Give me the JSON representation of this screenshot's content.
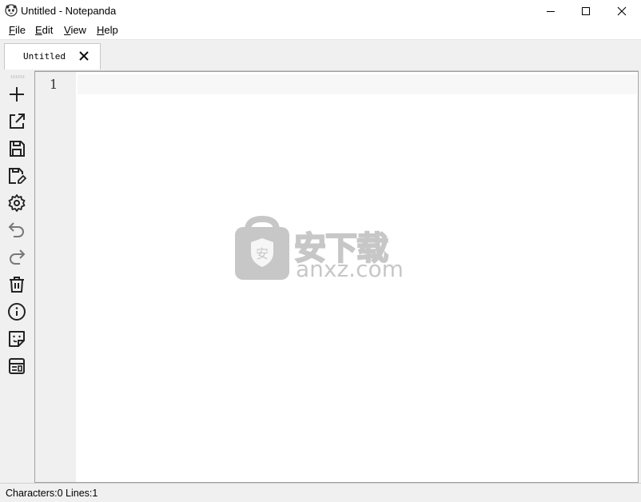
{
  "window": {
    "title": "Untitled - Notepanda"
  },
  "menu": {
    "items": [
      {
        "label": "File",
        "mnemonic": "F",
        "rest": "ile"
      },
      {
        "label": "Edit",
        "mnemonic": "E",
        "rest": "dit"
      },
      {
        "label": "View",
        "mnemonic": "V",
        "rest": "iew"
      },
      {
        "label": "Help",
        "mnemonic": "H",
        "rest": "elp"
      }
    ]
  },
  "tabs": [
    {
      "label": "Untitled",
      "active": true
    }
  ],
  "toolbar": {
    "tools": [
      "new-file-icon",
      "open-file-icon",
      "save-icon",
      "save-as-icon",
      "settings-icon",
      "undo-icon",
      "redo-icon",
      "delete-icon",
      "info-icon",
      "sticky-note-icon",
      "layout-icon"
    ]
  },
  "editor": {
    "line_numbers": [
      "1"
    ],
    "content": ""
  },
  "watermark": {
    "shield_char": "安",
    "text_cn": "安下载",
    "text_en": "anxz.com"
  },
  "status": {
    "text": "Characters:0 Lines:1"
  },
  "colors": {
    "editor_bg": "#ffffff",
    "gutter_bg": "#f0f0f0",
    "current_line": "#f7f7f7",
    "chrome": "#f0f0f0"
  }
}
